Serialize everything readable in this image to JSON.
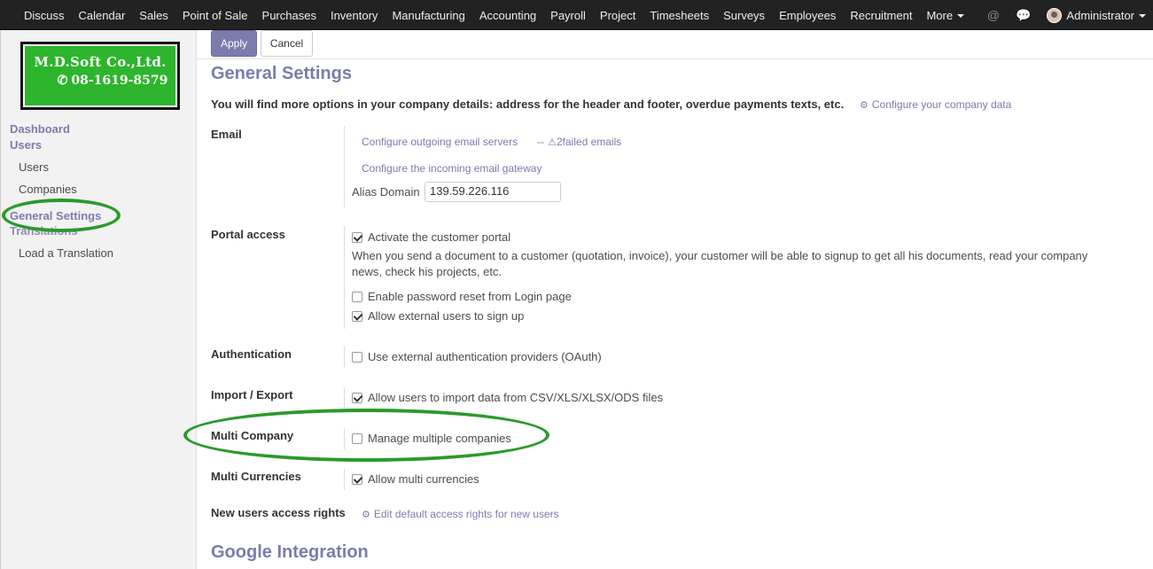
{
  "topnav": {
    "items": [
      "Discuss",
      "Calendar",
      "Sales",
      "Point of Sale",
      "Purchases",
      "Inventory",
      "Manufacturing",
      "Accounting",
      "Payroll",
      "Project",
      "Timesheets",
      "Surveys",
      "Employees",
      "Recruitment"
    ],
    "more_label": "More",
    "user": "Administrator",
    "icons": [
      "at-icon",
      "chat-icon"
    ]
  },
  "logo": {
    "title": "M.D.Soft Co.,Ltd.",
    "phone": "08-1619-8579"
  },
  "sidebar": {
    "sections": [
      {
        "title": "Dashboard"
      },
      {
        "title": "Users",
        "items": [
          "Users",
          "Companies"
        ]
      },
      {
        "title": "General Settings"
      },
      {
        "title": "Translations",
        "items": [
          "Load a Translation"
        ]
      }
    ]
  },
  "toolbar": {
    "apply_label": "Apply",
    "cancel_label": "Cancel"
  },
  "page": {
    "title": "General Settings",
    "intro": "You will find more options in your company details: address for the header and footer, overdue payments texts, etc.",
    "intro_link": "Configure your company data"
  },
  "email": {
    "label": "Email",
    "outgoing_link": "Configure outgoing email servers",
    "separator": "--",
    "failed_link": "2failed emails",
    "incoming_link": "Configure the incoming email gateway",
    "alias_label": "Alias Domain",
    "alias_value": "139.59.226.116"
  },
  "portal": {
    "label": "Portal access",
    "activate": "Activate the customer portal",
    "description": "When you send a document to a customer (quotation, invoice), your customer will be able to signup to get all his documents, read your company news, check his projects, etc.",
    "reset": "Enable password reset from Login page",
    "signup": "Allow external users to sign up"
  },
  "auth": {
    "label": "Authentication",
    "oauth": "Use external authentication providers (OAuth)"
  },
  "import": {
    "label": "Import / Export",
    "option": "Allow users to import data from CSV/XLS/XLSX/ODS files"
  },
  "multicompany": {
    "label": "Multi Company",
    "option": "Manage multiple companies"
  },
  "currencies": {
    "label": "Multi Currencies",
    "option": "Allow multi currencies"
  },
  "access": {
    "label": "New users access rights",
    "link": "Edit default access rights for new users"
  },
  "google": {
    "title": "Google Integration"
  },
  "checks": {
    "activate": true,
    "reset": false,
    "signup": true,
    "oauth": false,
    "import": true,
    "multicompany": false,
    "currencies": true
  },
  "colors": {
    "accent": "#7c7bad",
    "nav": "#222222",
    "highlight": "#2a9a2a"
  }
}
